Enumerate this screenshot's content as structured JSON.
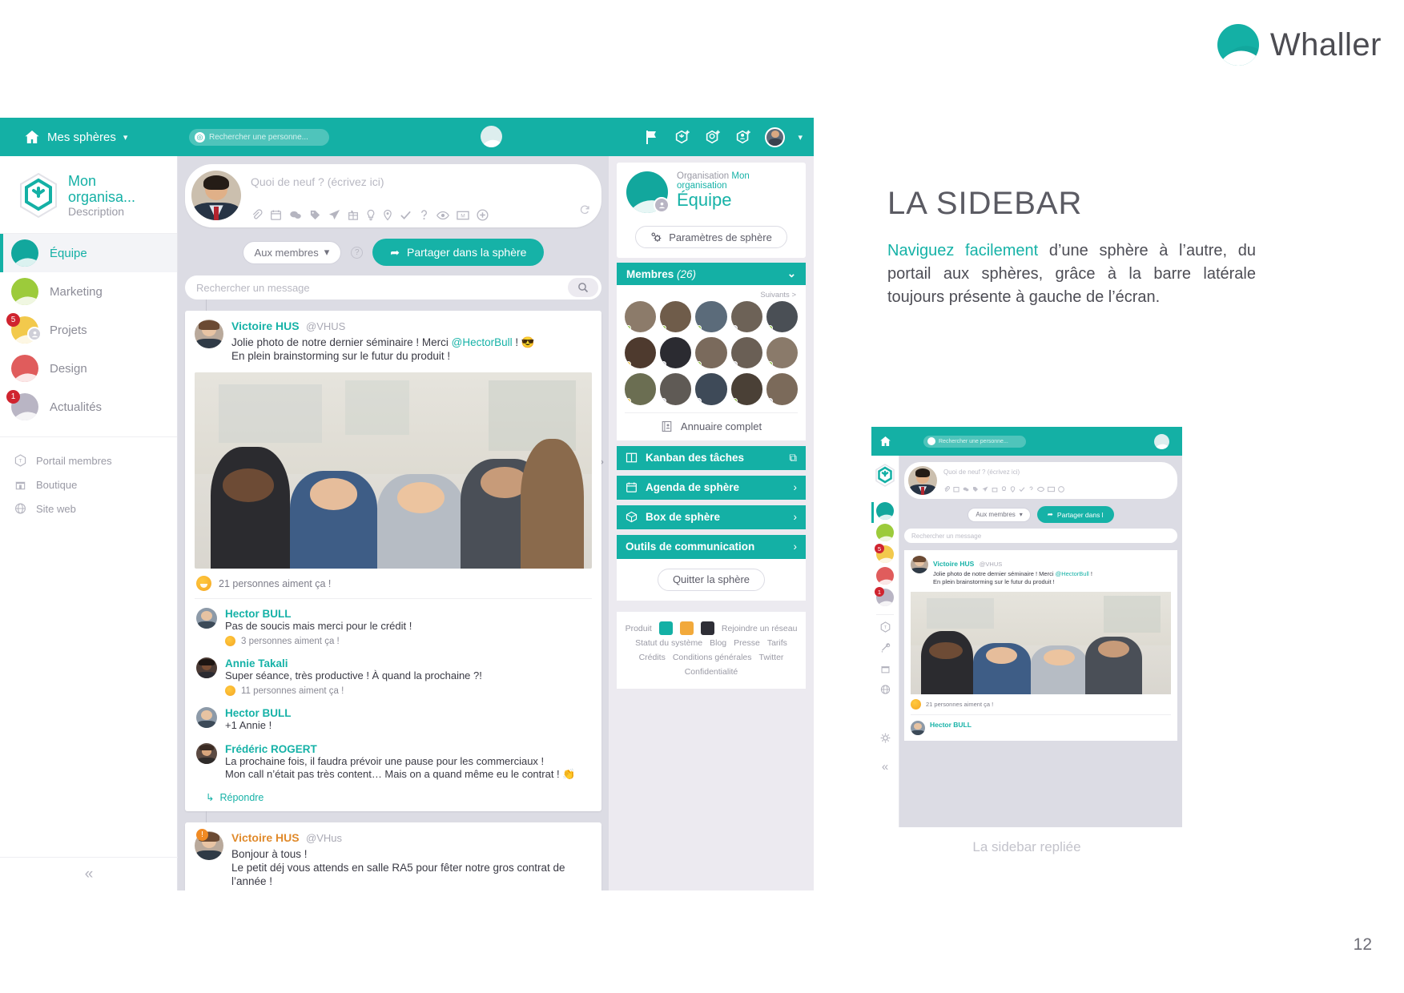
{
  "brand": {
    "name": "Whaller",
    "logo_icon": "whaller-sphere-logo",
    "accent": "#14b0a5"
  },
  "slide": {
    "title": "LA SIDEBAR",
    "paragraph_highlight": "Naviguez facilement",
    "paragraph_rest": " d’une sphère à l’autre, du portail aux sphères, grâce à la barre latérale toujours présente à gauche de l’écran.",
    "caption": "La sidebar repliée",
    "page_number": "12"
  },
  "topbar": {
    "home_icon": "home-icon",
    "menu_label": "Mes sphères",
    "caret_icon": "chevron-down-icon",
    "search_placeholder": "Rechercher une personne...",
    "search_icon": "search-icon",
    "center_logo_icon": "whaller-sphere-logo",
    "icons": [
      "flag-icon",
      "add-sphere-icon",
      "add-network-icon",
      "add-contact-icon"
    ],
    "avatar_icon": "user-avatar",
    "avatar_caret_icon": "chevron-down-icon"
  },
  "sidebar": {
    "org_name": "Mon organisa...",
    "org_description": "Description",
    "org_logo_icon": "hexagon-org-logo",
    "spheres": [
      {
        "label": "Équipe",
        "color": "#12a79d",
        "active": true,
        "badge": null,
        "sub_icon": null
      },
      {
        "label": "Marketing",
        "color": "#9ccb3b",
        "active": false,
        "badge": null,
        "sub_icon": null
      },
      {
        "label": "Projets",
        "color": "#f2c94c",
        "active": false,
        "badge": "5",
        "sub_icon": "group-icon"
      },
      {
        "label": "Design",
        "color": "#e05c5c",
        "active": false,
        "badge": null,
        "sub_icon": null
      },
      {
        "label": "Actualités",
        "color": "#b9b5c4",
        "active": false,
        "badge": "1",
        "sub_icon": null
      }
    ],
    "links": [
      {
        "label": "Portail membres",
        "icon": "portal-hexagon-icon"
      },
      {
        "label": "Boutique",
        "icon": "shop-icon"
      },
      {
        "label": "Site web",
        "icon": "globe-icon"
      }
    ],
    "collapse_icon": "double-chevron-left-icon"
  },
  "composer": {
    "avatar_icon": "user-avatar",
    "placeholder": "Quoi de neuf ? (écrivez ici)",
    "tools": [
      "attach-icon",
      "calendar-icon",
      "chat-icon",
      "tag-icon",
      "send-icon",
      "gift-icon",
      "bulb-icon",
      "pin-icon",
      "check-icon",
      "question-icon",
      "eye-icon",
      "mail-icon",
      "plus-circle-icon"
    ],
    "refresh_icon": "refresh-icon",
    "audience_label": "Aux membres",
    "audience_caret_icon": "caret-down-icon",
    "help_icon": "question-circle-icon",
    "share_label": "Partager dans la sphère",
    "share_icon": "share-arrow-icon"
  },
  "feed": {
    "search_placeholder": "Rechercher un message",
    "search_icon": "search-icon",
    "next_icon": "chevron-right-icon",
    "posts": [
      {
        "author": "Victoire HUS",
        "handle": "@VHUS",
        "text_line1_a": "Jolie photo de notre dernier séminaire ! Merci ",
        "text_mention": "@HectorBull",
        "text_line1_b": " !",
        "emoji": "😎",
        "text_line2": "En plein brainstorming sur le futur du produit !",
        "has_photo": true,
        "likes": "21 personnes aiment ça !",
        "comments": [
          {
            "author": "Hector BULL",
            "text": "Pas de soucis mais merci pour le crédit !",
            "likes": "3 personnes aiment ça !"
          },
          {
            "author": "Annie Takali",
            "text": "Super séance, très productive ! À quand la prochaine ?!",
            "likes": "11 personnes aiment ça !"
          },
          {
            "author": "Hector BULL",
            "text": "+1 Annie !",
            "likes": null
          },
          {
            "author": "Frédéric ROGERT",
            "text": "La prochaine fois, il faudra prévoir une pause pour les commerciaux !",
            "text2": "Mon call n’était pas très content… Mais on a quand même eu le contrat ! 👏",
            "likes": null
          }
        ],
        "reply_label": "Répondre",
        "reply_icon": "reply-arrow-icon"
      },
      {
        "author": "Victoire HUS",
        "handle": "@VHus",
        "alert_icon": "alert-icon",
        "text_line1": "Bonjour à tous !",
        "text_line2": "Le petit déj vous attends en salle RA5 pour fêter notre gros contrat de",
        "text_line3": "l’année !"
      }
    ]
  },
  "right_panel": {
    "org_prefix": "Organisation",
    "org_name": "Mon organisation",
    "sphere_title": "Équipe",
    "sphere_icon": "sphere-ball-icon",
    "sphere_sub_icon": "group-icon",
    "settings_label": "Paramètres de sphère",
    "settings_icon": "gears-icon",
    "members_label": "Membres",
    "members_count": "(26)",
    "members_caret_icon": "chevron-down-icon",
    "next_members_label": "Suivants >",
    "directory_label": "Annuaire complet",
    "directory_icon": "address-book-icon",
    "actions": [
      {
        "label": "Kanban des tâches",
        "icon": "kanban-icon",
        "right_icon": "external-link-icon"
      },
      {
        "label": "Agenda de sphère",
        "icon": "calendar-icon",
        "right_icon": "chevron-right-icon"
      },
      {
        "label": "Box de sphère",
        "icon": "box-icon",
        "right_icon": "chevron-right-icon"
      },
      {
        "label": "Outils de communication",
        "icon": null,
        "right_icon": "chevron-right-icon"
      }
    ],
    "quit_label": "Quitter la sphère",
    "footer": {
      "produit_label": "Produit",
      "rejoindre_label": "Rejoindre un réseau",
      "status_label": "Statut du système",
      "blog_label": "Blog",
      "presse_label": "Presse",
      "tarifs_label": "Tarifs",
      "credits_label": "Crédits",
      "cgu_label": "Conditions générales",
      "twitter_label": "Twitter",
      "confidentialite_label": "Confidentialité"
    }
  },
  "mini": {
    "search_placeholder": "Rechercher une personne...",
    "home_icon": "home-icon",
    "composer_placeholder": "Quoi de neuf ? (écrivez ici)",
    "audience_label": "Aux membres",
    "share_label": "Partager dans l",
    "search_message_placeholder": "Rechercher un message",
    "post_author": "Victoire HUS",
    "post_handle": "@VHUS",
    "post_line1_a": "Jolie photo de notre dernier séminaire ! Merci ",
    "post_mention": "@HectorBull",
    "post_line1_b": " !",
    "post_line2": "En plein brainstorming sur le futur du produit !",
    "likes": "21 personnes aiment ça !",
    "comment_author": "Hector BULL",
    "rail_icons": [
      "portal-hexagon-icon",
      "tools-icon",
      "shop-icon",
      "globe-icon",
      "gear-icon",
      "double-chevron-left-icon"
    ],
    "spheres": [
      {
        "color": "#12a79d",
        "badge": null,
        "active": true
      },
      {
        "color": "#9ccb3b",
        "badge": null,
        "active": false
      },
      {
        "color": "#f2c94c",
        "badge": "5",
        "active": false
      },
      {
        "color": "#e05c5c",
        "badge": null,
        "active": false
      },
      {
        "color": "#b9b5c4",
        "badge": "1",
        "active": false
      }
    ]
  }
}
